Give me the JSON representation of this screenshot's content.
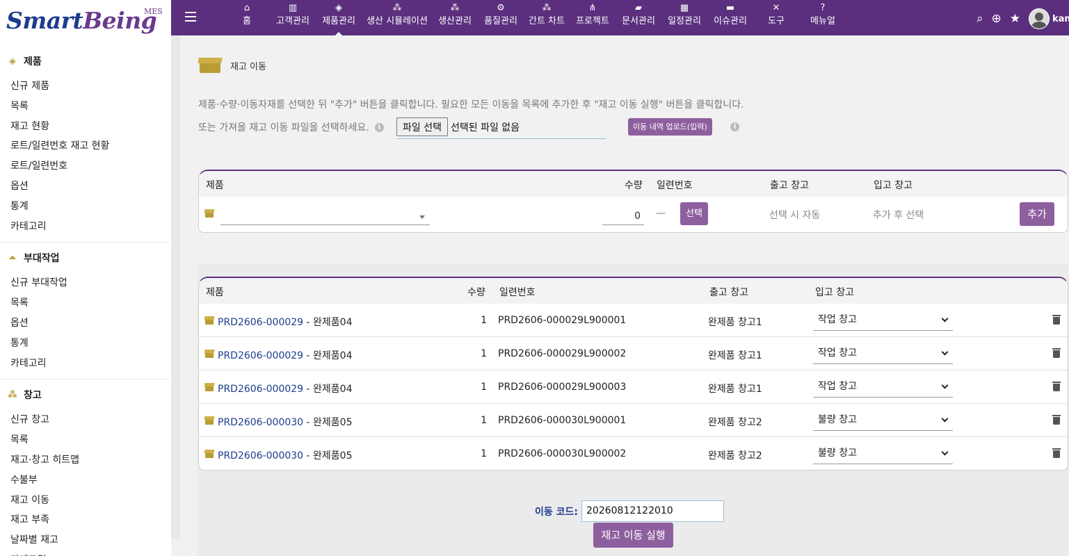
{
  "logo": {
    "smart": "Smart",
    "being": "Being",
    "mes": "MES"
  },
  "nav": {
    "items": [
      {
        "label": "홈",
        "icon": "home-icon",
        "glyph": "⌂"
      },
      {
        "label": "고객관리",
        "icon": "building-icon",
        "glyph": "▥"
      },
      {
        "label": "제품관리",
        "icon": "cube-icon",
        "glyph": "◈"
      },
      {
        "label": "생산 시뮬레이션",
        "icon": "cubes-icon",
        "glyph": "⁂"
      },
      {
        "label": "생산관리",
        "icon": "cubes-icon",
        "glyph": "⁂"
      },
      {
        "label": "품질관리",
        "icon": "cogs-icon",
        "glyph": "⚙"
      },
      {
        "label": "간트 차트",
        "icon": "cubes-icon",
        "glyph": "⁂"
      },
      {
        "label": "프로젝트",
        "icon": "sitemap-icon",
        "glyph": "⋔"
      },
      {
        "label": "문서관리",
        "icon": "folder-icon",
        "glyph": "▰"
      },
      {
        "label": "일정관리",
        "icon": "calendar-icon",
        "glyph": "▦"
      },
      {
        "label": "이슈관리",
        "icon": "money-icon",
        "glyph": "▬"
      },
      {
        "label": "도구",
        "icon": "tools-icon",
        "glyph": "✕"
      },
      {
        "label": "메뉴얼",
        "icon": "question-icon",
        "glyph": "?"
      }
    ],
    "active_index": 2,
    "username": "kame"
  },
  "sidebar": {
    "groups": [
      {
        "title": "제품",
        "icon": "cube-icon",
        "glyph": "◈",
        "items": [
          "신규 제품",
          "목록",
          "재고 현황",
          "로트/일련번호 재고 현황",
          "로트/일련번호",
          "옵션",
          "통계",
          "카테고리"
        ]
      },
      {
        "title": "부대작업",
        "icon": "bell-icon",
        "glyph": "⏶",
        "items": [
          "신규 부대작업",
          "목록",
          "옵션",
          "통계",
          "카테고리"
        ]
      },
      {
        "title": "창고",
        "icon": "boxes-icon",
        "glyph": "⁂",
        "items": [
          "신규 창고",
          "목록",
          "재고·창고 히트맵",
          "수불부",
          "재고 이동",
          "재고 부족",
          "날짜별 재고",
          "카테고리"
        ]
      }
    ]
  },
  "page": {
    "title": "재고 이동",
    "desc1": "제품·수량·이동자재를 선택한 뒤 \"추가\" 버튼을 클릭합니다. 필요한 모든 이동을 목록에 추가한 후 \"재고 이동 실행\" 버튼을 클릭합니다.",
    "desc2": "또는 가져올 재고 이동 파일을 선택하세요.",
    "file_button": "파일 선택",
    "file_none": "선택된 파일 없음",
    "upload_button": "이동 내역 업로드(입력)"
  },
  "add_form": {
    "headers": {
      "product": "제품",
      "qty": "수량",
      "serial": "일련번호",
      "out": "출고 창고",
      "in": "입고 창고"
    },
    "qty_value": "0",
    "dash": "—",
    "select_button": "선택",
    "auto_text": "선택 시 자동",
    "after_text": "추가 후 선택",
    "add_button": "추가"
  },
  "list": {
    "headers": {
      "product": "제품",
      "qty": "수량",
      "serial": "일련번호",
      "out": "출고 창고",
      "in": "입고 창고"
    },
    "rows": [
      {
        "code": "PRD2606-000029",
        "name": " - 완제품04",
        "qty": "1",
        "serial": "PRD2606-000029L900001",
        "out": "완제품 창고1",
        "in": "작업 창고"
      },
      {
        "code": "PRD2606-000029",
        "name": " - 완제품04",
        "qty": "1",
        "serial": "PRD2606-000029L900002",
        "out": "완제품 창고1",
        "in": "작업 창고"
      },
      {
        "code": "PRD2606-000029",
        "name": " - 완제품04",
        "qty": "1",
        "serial": "PRD2606-000029L900003",
        "out": "완제품 창고1",
        "in": "작업 창고"
      },
      {
        "code": "PRD2606-000030",
        "name": " - 완제품05",
        "qty": "1",
        "serial": "PRD2606-000030L900001",
        "out": "완제품 창고2",
        "in": "불량 창고"
      },
      {
        "code": "PRD2606-000030",
        "name": " - 완제품05",
        "qty": "1",
        "serial": "PRD2606-000030L900002",
        "out": "완제품 창고2",
        "in": "불량 창고"
      }
    ]
  },
  "footer": {
    "code_label": "이동 코드:",
    "code_value": "20260812122010",
    "exec_button": "재고 이동 실행"
  },
  "colors": {
    "nav_bg": "#5b2f7e",
    "button": "#8e5f9e",
    "link": "#1d3c8c",
    "icon_gold": "#b99c35"
  }
}
